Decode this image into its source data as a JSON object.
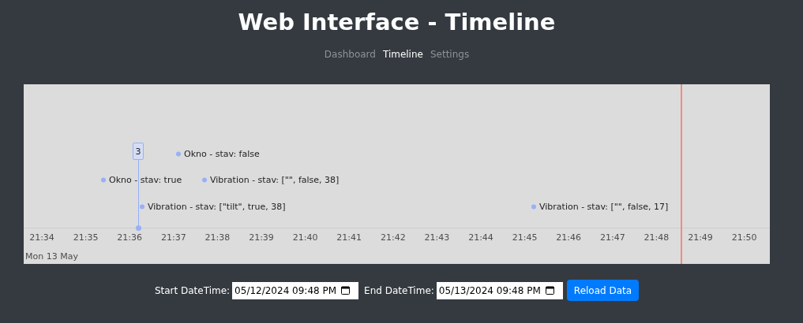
{
  "title": "Web Interface - Timeline",
  "nav": [
    {
      "label": "Dashboard",
      "selected": false
    },
    {
      "label": "Timeline",
      "selected": true
    },
    {
      "label": "Settings",
      "selected": false
    }
  ],
  "timeline": {
    "cluster": {
      "count": "3"
    },
    "items": [
      {
        "label": "Okno - stav: false"
      },
      {
        "label": "Okno - stav: true"
      },
      {
        "label": "Vibration - stav: [\"\", false, 38]"
      },
      {
        "label": "Vibration - stav: [\"tilt\", true, 38]"
      },
      {
        "label": "Vibration - stav: [\"\", false, 17]"
      }
    ],
    "ticks": [
      "21:34",
      "21:35",
      "21:36",
      "21:37",
      "21:38",
      "21:39",
      "21:40",
      "21:41",
      "21:42",
      "21:43",
      "21:44",
      "21:45",
      "21:46",
      "21:47",
      "21:48",
      "21:49",
      "21:50"
    ],
    "date_label": "Mon 13 May"
  },
  "controls": {
    "start_label": "Start DateTime:",
    "start_value": "05/12/2024 09:48 PM",
    "end_label": "End DateTime:",
    "end_value": "05/13/2024 09:48 PM",
    "button": "Reload Data"
  }
}
